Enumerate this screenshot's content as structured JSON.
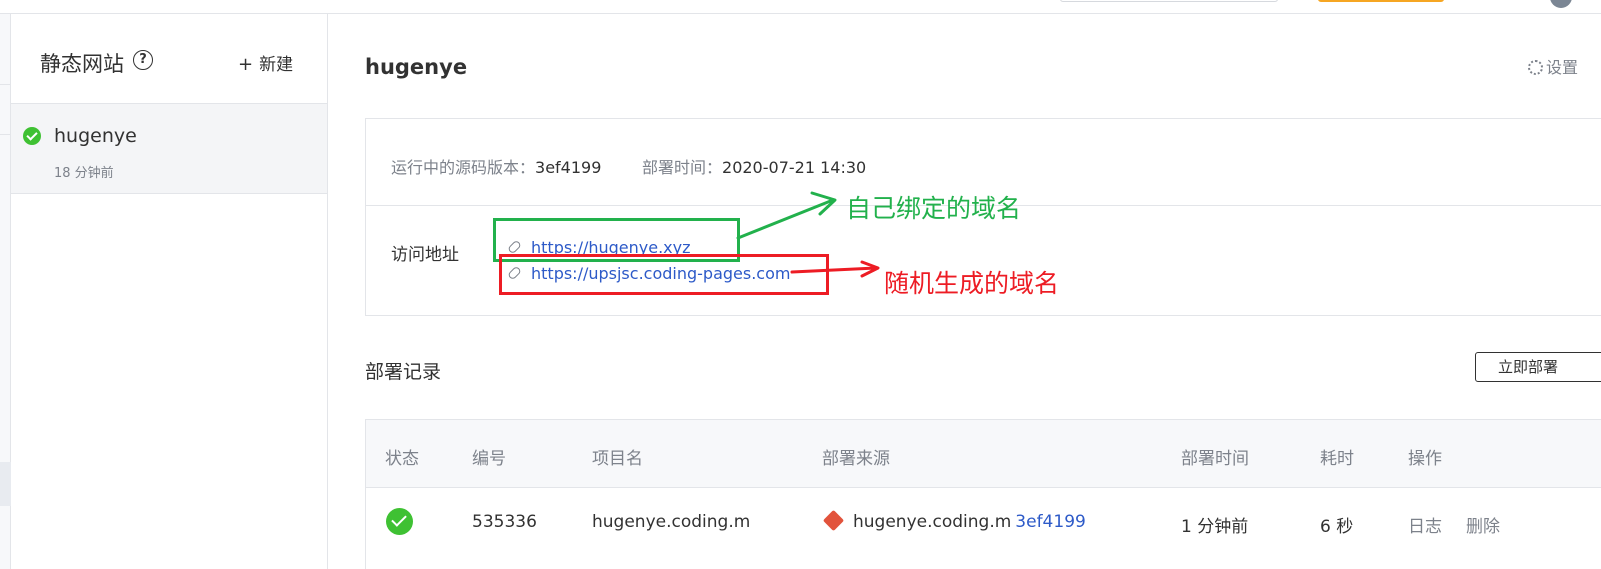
{
  "sidebar": {
    "title": "静态网站",
    "help_icon": "question-circle-icon",
    "new_button": "新建",
    "sites": [
      {
        "name": "hugenye",
        "time": "18 分钟前",
        "status_icon": "success-check-icon"
      }
    ]
  },
  "site": {
    "title": "hugenye",
    "settings_label": "设置",
    "source_version_label": "运行中的源码版本：",
    "source_version": "3ef4199",
    "deploy_time_label": "部署时间：",
    "deploy_time": "2020-07-21 14:30",
    "access_label": "访问地址",
    "links": [
      "https://hugenye.xyz",
      "https://upsjsc.coding-pages.com"
    ]
  },
  "annotations": {
    "custom_domain": "自己绑定的域名",
    "random_domain": "随机生成的域名",
    "custom_color": "#22b14c",
    "random_color": "#ed1c24"
  },
  "records": {
    "title": "部署记录",
    "deploy_now_button": "立即部署",
    "columns": [
      "状态",
      "编号",
      "项目名",
      "部署来源",
      "部署时间",
      "耗时",
      "操作"
    ],
    "rows": [
      {
        "status_icon": "success-check-icon",
        "id": "535336",
        "project": "hugenye.coding.m",
        "source_icon": "git-icon",
        "source_repo": "hugenye.coding.m",
        "source_commit": "3ef4199",
        "time": "1 分钟前",
        "duration": "6 秒",
        "actions": [
          "日志",
          "删除"
        ]
      }
    ]
  },
  "colors": {
    "success": "#3fc133",
    "link": "#2d5ac8",
    "brand_orange": "#f6a623"
  }
}
